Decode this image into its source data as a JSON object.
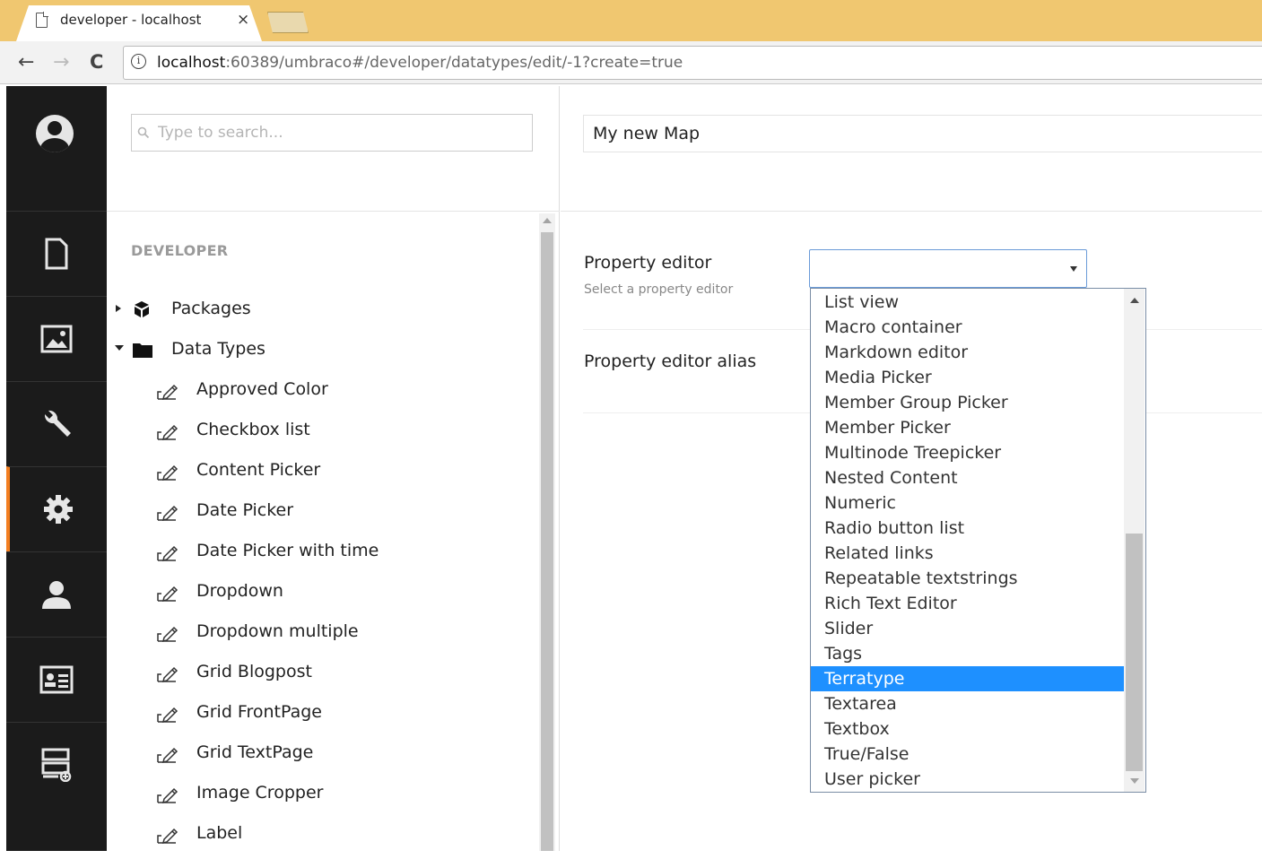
{
  "browser": {
    "tab_title": "developer - localhost",
    "tab_close": "×",
    "url_host": "localhost",
    "url_rest": ":60389/umbraco#/developer/datatypes/edit/-1?create=true",
    "back_icon": "←",
    "forward_icon": "→",
    "reload_icon": "C",
    "info_icon": "i"
  },
  "sections": [
    {
      "name": "content",
      "icon": "document-icon"
    },
    {
      "name": "media",
      "icon": "image-icon"
    },
    {
      "name": "settings",
      "icon": "wrench-icon"
    },
    {
      "name": "developer",
      "icon": "gear-icon",
      "active": true
    },
    {
      "name": "users",
      "icon": "user-icon"
    },
    {
      "name": "members",
      "icon": "id-card-icon"
    },
    {
      "name": "forms",
      "icon": "forms-icon"
    }
  ],
  "tree": {
    "search_placeholder": "Type to search...",
    "heading": "DEVELOPER",
    "packages_label": "Packages",
    "datatypes_label": "Data Types",
    "items": [
      "Approved Color",
      "Checkbox list",
      "Content Picker",
      "Date Picker",
      "Date Picker with time",
      "Dropdown",
      "Dropdown multiple",
      "Grid Blogpost",
      "Grid FrontPage",
      "Grid TextPage",
      "Image Cropper",
      "Label"
    ]
  },
  "editor": {
    "name_value": "My new Map",
    "property_editor_label": "Property editor",
    "property_editor_desc": "Select a property editor",
    "property_editor_alias_label": "Property editor alias",
    "selected_value": ""
  },
  "dropdown": {
    "options": [
      "List view",
      "Macro container",
      "Markdown editor",
      "Media Picker",
      "Member Group Picker",
      "Member Picker",
      "Multinode Treepicker",
      "Nested Content",
      "Numeric",
      "Radio button list",
      "Related links",
      "Repeatable textstrings",
      "Rich Text Editor",
      "Slider",
      "Tags",
      "Terratype",
      "Textarea",
      "Textbox",
      "True/False",
      "User picker"
    ],
    "highlighted": "Terratype"
  },
  "colors": {
    "accent": "#f37e20",
    "selection": "#1e90ff",
    "sidebar": "#1b1b1b",
    "tabstrip": "#f0c770"
  }
}
